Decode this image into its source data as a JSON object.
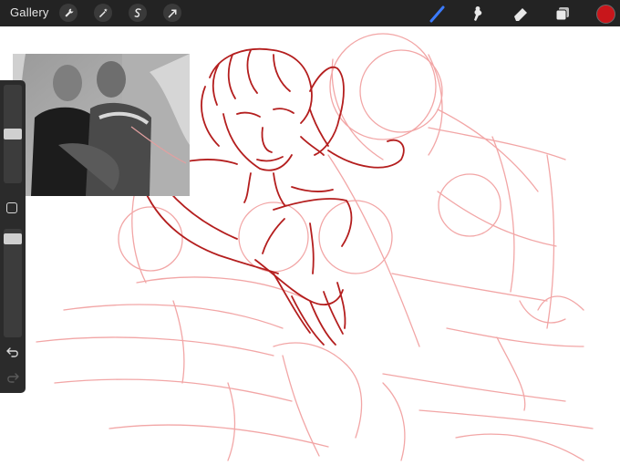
{
  "toolbar": {
    "gallery_label": "Gallery",
    "actions": [
      "wrench-icon",
      "magic-wand-icon",
      "selection-icon",
      "transform-arrow-icon"
    ],
    "tools": [
      "brush-icon",
      "smudge-icon",
      "eraser-icon",
      "layers-icon"
    ],
    "active_tool": "brush-icon",
    "accent_color": "#3b7bff",
    "current_color": "#c8161b"
  },
  "sidebar": {
    "brush_size_level": 0.45,
    "opacity_level": 0.12,
    "controls": [
      "brush-size-slider",
      "modify-button",
      "opacity-slider",
      "undo-icon",
      "redo-icon"
    ]
  },
  "canvas": {
    "reference_image": "grayscale-photo-two-men",
    "sketch_color": "#b41e1e",
    "guide_color": "#f2a6a6"
  }
}
